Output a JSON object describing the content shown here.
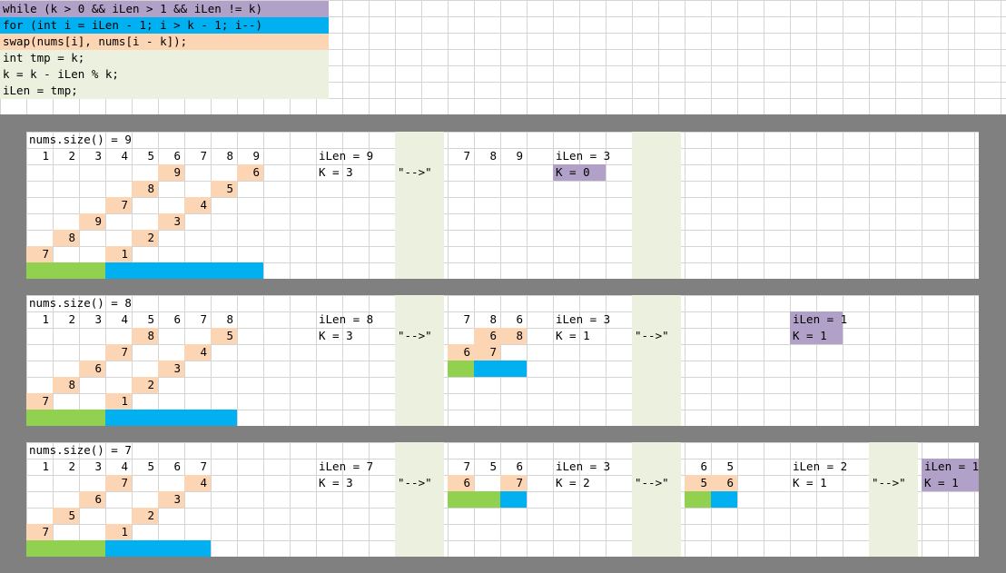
{
  "colors": {
    "purple": "#b1a0c7",
    "blue": "#00b0f0",
    "peach": "#fcd5b4",
    "light_green": "#ebf1de",
    "green": "#92d050",
    "frame_gray": "#808080"
  },
  "code_lines": [
    {
      "text": "while (k > 0 && iLen > 1 && iLen != k)",
      "color": "purple"
    },
    {
      "text": "for (int i = iLen - 1; i > k - 1; i--)",
      "color": "blue"
    },
    {
      "text": "swap(nums[i], nums[i - k]);",
      "color": "peach"
    },
    {
      "text": "int tmp = k;",
      "color": "light_green"
    },
    {
      "text": "k = k - iLen % k;",
      "color": "light_green"
    },
    {
      "text": "iLen = tmp;",
      "color": "light_green"
    }
  ],
  "panels": [
    {
      "title": "nums.size() = 9",
      "bands": [
        14,
        23
      ],
      "cells": [
        {
          "r": 1,
          "c": 0,
          "t": "1"
        },
        {
          "r": 1,
          "c": 1,
          "t": "2"
        },
        {
          "r": 1,
          "c": 2,
          "t": "3"
        },
        {
          "r": 1,
          "c": 3,
          "t": "4"
        },
        {
          "r": 1,
          "c": 4,
          "t": "5"
        },
        {
          "r": 1,
          "c": 5,
          "t": "6"
        },
        {
          "r": 1,
          "c": 6,
          "t": "7"
        },
        {
          "r": 1,
          "c": 7,
          "t": "8"
        },
        {
          "r": 1,
          "c": 8,
          "t": "9"
        },
        {
          "r": 2,
          "c": 5,
          "t": "9",
          "bg": "peach"
        },
        {
          "r": 2,
          "c": 8,
          "t": "6",
          "bg": "peach"
        },
        {
          "r": 3,
          "c": 4,
          "t": "8",
          "bg": "peach"
        },
        {
          "r": 3,
          "c": 7,
          "t": "5",
          "bg": "peach"
        },
        {
          "r": 4,
          "c": 3,
          "t": "7",
          "bg": "peach"
        },
        {
          "r": 4,
          "c": 6,
          "t": "4",
          "bg": "peach"
        },
        {
          "r": 5,
          "c": 2,
          "t": "9",
          "bg": "peach"
        },
        {
          "r": 5,
          "c": 5,
          "t": "3",
          "bg": "peach"
        },
        {
          "r": 6,
          "c": 1,
          "t": "8",
          "bg": "peach"
        },
        {
          "r": 6,
          "c": 4,
          "t": "2",
          "bg": "peach"
        },
        {
          "r": 7,
          "c": 0,
          "t": "7",
          "bg": "peach"
        },
        {
          "r": 7,
          "c": 3,
          "t": "1",
          "bg": "peach"
        },
        {
          "r": 1,
          "c": 16,
          "t": "7"
        },
        {
          "r": 1,
          "c": 17,
          "t": "8"
        },
        {
          "r": 1,
          "c": 18,
          "t": "9"
        }
      ],
      "texts": [
        {
          "r": 1,
          "c": 11,
          "t": "iLen = 9"
        },
        {
          "r": 2,
          "c": 11,
          "t": "K = 3"
        },
        {
          "r": 2,
          "c": 14,
          "t": "\"-->\""
        },
        {
          "r": 1,
          "c": 20,
          "t": "iLen = 3"
        },
        {
          "r": 2,
          "c": 20,
          "t": "K = 0",
          "bg": "purple",
          "span": 2
        }
      ],
      "bars": [
        {
          "r": 8,
          "c": 0,
          "span": 3,
          "color": "green"
        },
        {
          "r": 8,
          "c": 3,
          "span": 6,
          "color": "blue"
        }
      ]
    },
    {
      "title": "nums.size() = 8",
      "bands": [
        14,
        23
      ],
      "cells": [
        {
          "r": 1,
          "c": 0,
          "t": "1"
        },
        {
          "r": 1,
          "c": 1,
          "t": "2"
        },
        {
          "r": 1,
          "c": 2,
          "t": "3"
        },
        {
          "r": 1,
          "c": 3,
          "t": "4"
        },
        {
          "r": 1,
          "c": 4,
          "t": "5"
        },
        {
          "r": 1,
          "c": 5,
          "t": "6"
        },
        {
          "r": 1,
          "c": 6,
          "t": "7"
        },
        {
          "r": 1,
          "c": 7,
          "t": "8"
        },
        {
          "r": 2,
          "c": 4,
          "t": "8",
          "bg": "peach"
        },
        {
          "r": 2,
          "c": 7,
          "t": "5",
          "bg": "peach"
        },
        {
          "r": 3,
          "c": 3,
          "t": "7",
          "bg": "peach"
        },
        {
          "r": 3,
          "c": 6,
          "t": "4",
          "bg": "peach"
        },
        {
          "r": 4,
          "c": 2,
          "t": "6",
          "bg": "peach"
        },
        {
          "r": 4,
          "c": 5,
          "t": "3",
          "bg": "peach"
        },
        {
          "r": 5,
          "c": 1,
          "t": "8",
          "bg": "peach"
        },
        {
          "r": 5,
          "c": 4,
          "t": "2",
          "bg": "peach"
        },
        {
          "r": 6,
          "c": 0,
          "t": "7",
          "bg": "peach"
        },
        {
          "r": 6,
          "c": 3,
          "t": "1",
          "bg": "peach"
        },
        {
          "r": 1,
          "c": 16,
          "t": "7"
        },
        {
          "r": 1,
          "c": 17,
          "t": "8"
        },
        {
          "r": 1,
          "c": 18,
          "t": "6"
        },
        {
          "r": 2,
          "c": 17,
          "t": "6",
          "bg": "peach"
        },
        {
          "r": 2,
          "c": 18,
          "t": "8",
          "bg": "peach"
        },
        {
          "r": 3,
          "c": 16,
          "t": "6",
          "bg": "peach"
        },
        {
          "r": 3,
          "c": 17,
          "t": "7",
          "bg": "peach"
        }
      ],
      "texts": [
        {
          "r": 1,
          "c": 11,
          "t": "iLen = 8"
        },
        {
          "r": 2,
          "c": 11,
          "t": "K = 3"
        },
        {
          "r": 2,
          "c": 14,
          "t": "\"-->\""
        },
        {
          "r": 1,
          "c": 20,
          "t": "iLen = 3"
        },
        {
          "r": 2,
          "c": 20,
          "t": "K = 1"
        },
        {
          "r": 2,
          "c": 23,
          "t": "\"-->\""
        },
        {
          "r": 1,
          "c": 29,
          "t": "iLen = 1",
          "bg": "purple",
          "span": 2
        },
        {
          "r": 2,
          "c": 29,
          "t": "K = 1",
          "bg": "purple",
          "span": 2
        }
      ],
      "bars": [
        {
          "r": 7,
          "c": 0,
          "span": 3,
          "color": "green"
        },
        {
          "r": 7,
          "c": 3,
          "span": 5,
          "color": "blue"
        },
        {
          "r": 4,
          "c": 16,
          "span": 1,
          "color": "green"
        },
        {
          "r": 4,
          "c": 17,
          "span": 2,
          "color": "blue"
        }
      ]
    },
    {
      "title": "nums.size() = 7",
      "bands": [
        14,
        23,
        32
      ],
      "cells": [
        {
          "r": 1,
          "c": 0,
          "t": "1"
        },
        {
          "r": 1,
          "c": 1,
          "t": "2"
        },
        {
          "r": 1,
          "c": 2,
          "t": "3"
        },
        {
          "r": 1,
          "c": 3,
          "t": "4"
        },
        {
          "r": 1,
          "c": 4,
          "t": "5"
        },
        {
          "r": 1,
          "c": 5,
          "t": "6"
        },
        {
          "r": 1,
          "c": 6,
          "t": "7"
        },
        {
          "r": 2,
          "c": 3,
          "t": "7",
          "bg": "peach"
        },
        {
          "r": 2,
          "c": 6,
          "t": "4",
          "bg": "peach"
        },
        {
          "r": 3,
          "c": 2,
          "t": "6",
          "bg": "peach"
        },
        {
          "r": 3,
          "c": 5,
          "t": "3",
          "bg": "peach"
        },
        {
          "r": 4,
          "c": 1,
          "t": "5",
          "bg": "peach"
        },
        {
          "r": 4,
          "c": 4,
          "t": "2",
          "bg": "peach"
        },
        {
          "r": 5,
          "c": 0,
          "t": "7",
          "bg": "peach"
        },
        {
          "r": 5,
          "c": 3,
          "t": "1",
          "bg": "peach"
        },
        {
          "r": 1,
          "c": 16,
          "t": "7"
        },
        {
          "r": 1,
          "c": 17,
          "t": "5"
        },
        {
          "r": 1,
          "c": 18,
          "t": "6"
        },
        {
          "r": 2,
          "c": 16,
          "t": "6",
          "bg": "peach"
        },
        {
          "r": 2,
          "c": 18,
          "t": "7",
          "bg": "peach"
        },
        {
          "r": 1,
          "c": 25,
          "t": "6"
        },
        {
          "r": 1,
          "c": 26,
          "t": "5"
        },
        {
          "r": 2,
          "c": 25,
          "t": "5",
          "bg": "peach"
        },
        {
          "r": 2,
          "c": 26,
          "t": "6",
          "bg": "peach"
        }
      ],
      "texts": [
        {
          "r": 1,
          "c": 11,
          "t": "iLen = 7"
        },
        {
          "r": 2,
          "c": 11,
          "t": "K = 3"
        },
        {
          "r": 2,
          "c": 14,
          "t": "\"-->\""
        },
        {
          "r": 1,
          "c": 20,
          "t": "iLen = 3"
        },
        {
          "r": 2,
          "c": 20,
          "t": "K = 2"
        },
        {
          "r": 2,
          "c": 23,
          "t": "\"-->\""
        },
        {
          "r": 1,
          "c": 29,
          "t": "iLen = 2"
        },
        {
          "r": 2,
          "c": 29,
          "t": "K = 1"
        },
        {
          "r": 2,
          "c": 32,
          "t": "\"-->\""
        },
        {
          "r": 1,
          "c": 34,
          "t": "iLen = 1",
          "bg": "purple",
          "span": 3
        },
        {
          "r": 2,
          "c": 34,
          "t": "K = 1",
          "bg": "purple",
          "span": 3
        }
      ],
      "bars": [
        {
          "r": 6,
          "c": 0,
          "span": 3,
          "color": "green"
        },
        {
          "r": 6,
          "c": 3,
          "span": 4,
          "color": "blue"
        },
        {
          "r": 3,
          "c": 16,
          "span": 2,
          "color": "green"
        },
        {
          "r": 3,
          "c": 18,
          "span": 1,
          "color": "blue"
        },
        {
          "r": 3,
          "c": 25,
          "span": 1,
          "color": "green"
        },
        {
          "r": 3,
          "c": 26,
          "span": 1,
          "color": "blue"
        }
      ]
    }
  ]
}
